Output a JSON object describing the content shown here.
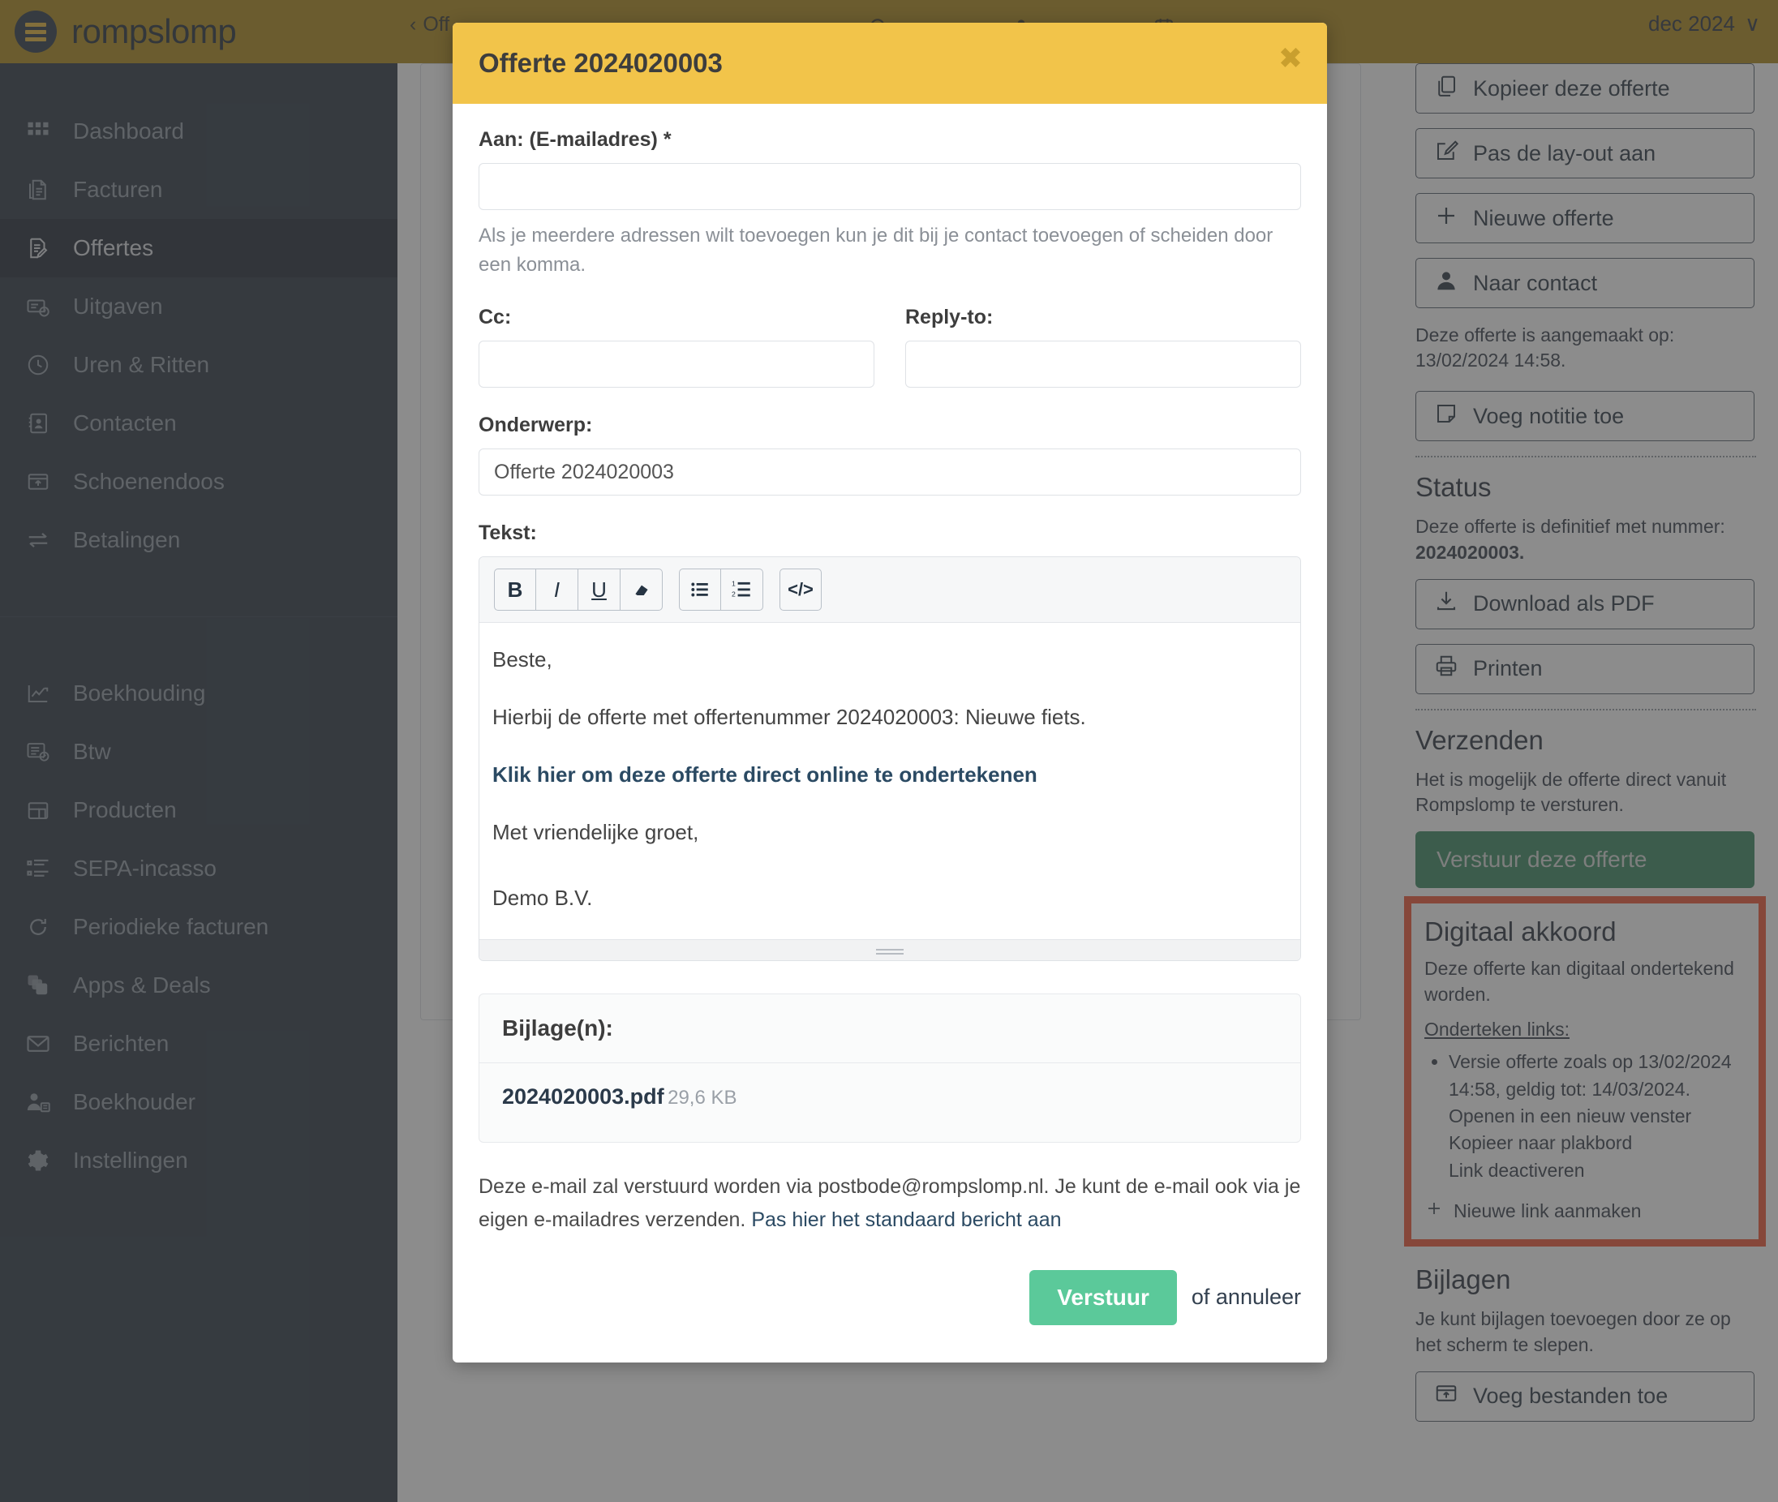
{
  "topbar": {
    "brand": "rompslomp",
    "breadcrumb": "Off",
    "back_chevron": "‹",
    "period": "dec 2024",
    "period_chevron": "∨"
  },
  "sidebar": {
    "group1": [
      {
        "label": "Dashboard",
        "icon": "grid-icon",
        "active": false
      },
      {
        "label": "Facturen",
        "icon": "invoice-icon",
        "active": false
      },
      {
        "label": "Offertes",
        "icon": "quote-edit-icon",
        "active": true
      },
      {
        "label": "Uitgaven",
        "icon": "expense-card-icon",
        "active": false
      },
      {
        "label": "Uren & Ritten",
        "icon": "clock-icon",
        "active": false
      },
      {
        "label": "Contacten",
        "icon": "contacts-icon",
        "active": false
      },
      {
        "label": "Schoenendoos",
        "icon": "inbox-upload-icon",
        "active": false
      },
      {
        "label": "Betalingen",
        "icon": "transfer-arrows-icon",
        "active": false
      }
    ],
    "group2": [
      {
        "label": "Boekhouding",
        "icon": "chart-up-icon",
        "active": false
      },
      {
        "label": "Btw",
        "icon": "vat-percent-icon",
        "active": false
      },
      {
        "label": "Producten",
        "icon": "box-icon",
        "active": false
      },
      {
        "label": "SEPA-incasso",
        "icon": "list-icon",
        "active": false
      },
      {
        "label": "Periodieke facturen",
        "icon": "refresh-icon",
        "active": false
      },
      {
        "label": "Apps & Deals",
        "icon": "stack-icon",
        "active": false
      },
      {
        "label": "Berichten",
        "icon": "envelope-icon",
        "active": false
      },
      {
        "label": "Boekhouder",
        "icon": "accountant-icon",
        "active": false
      },
      {
        "label": "Instellingen",
        "icon": "gear-icon",
        "active": false
      }
    ]
  },
  "rail": {
    "buttons_top": [
      {
        "label": "Kopieer deze offerte",
        "icon": "copy-icon"
      },
      {
        "label": "Pas de lay-out aan",
        "icon": "edit-square-icon"
      },
      {
        "label": "Nieuwe offerte",
        "icon": "plus-icon"
      },
      {
        "label": "Naar contact",
        "icon": "person-icon"
      }
    ],
    "created_note": "Deze offerte is aangemaakt op: 13/02/2024 14:58.",
    "note_button": {
      "label": "Voeg notitie toe",
      "icon": "note-icon"
    },
    "status": {
      "heading": "Status",
      "text_prefix": "Deze offerte is definitief met nummer:",
      "number": "2024020003.",
      "download_button": {
        "label": "Download als PDF",
        "icon": "download-icon"
      },
      "print_button": {
        "label": "Printen",
        "icon": "printer-icon"
      }
    },
    "send": {
      "heading": "Verzenden",
      "text": "Het is mogelijk de offerte direct vanuit Rompslomp te versturen.",
      "button_label": "Verstuur deze offerte"
    },
    "digital": {
      "heading": "Digitaal akkoord",
      "text": "Deze offerte kan digitaal ondertekend worden.",
      "sub": "Onderteken links:",
      "item": "Versie offerte zoals op 13/02/2024 14:58, geldig tot: 14/03/2024.",
      "links": [
        "Openen in een nieuw venster",
        "Kopieer naar plakbord",
        "Link deactiveren"
      ],
      "new_link": "Nieuwe link aanmaken",
      "highlight_color": "#f04b28"
    },
    "attachments": {
      "heading": "Bijlagen",
      "text": "Je kunt bijlagen toevoegen door ze op het scherm te slepen.",
      "button": {
        "label": "Voeg bestanden toe",
        "icon": "upload-box-icon"
      }
    }
  },
  "modal": {
    "title": "Offerte 2024020003",
    "close_glyph": "✖",
    "to_label": "Aan: (E-mailadres) *",
    "to_value": "",
    "to_help": "Als je meerdere adressen wilt toevoegen kun je dit bij je contact toevoegen of scheiden door een komma.",
    "cc_label": "Cc:",
    "cc_value": "",
    "reply_label": "Reply-to:",
    "reply_value": "",
    "subject_label": "Onderwerp:",
    "subject_value": "Offerte 2024020003",
    "text_label": "Tekst:",
    "toolbar": [
      {
        "name": "bold-icon",
        "glyph": "B"
      },
      {
        "name": "italic-icon",
        "glyph": "I"
      },
      {
        "name": "underline-icon",
        "glyph": "U"
      },
      {
        "name": "eraser-icon",
        "glyph": "▰"
      },
      {
        "name": "bullet-list-icon",
        "glyph": "☰"
      },
      {
        "name": "numbered-list-icon",
        "glyph": "☷"
      },
      {
        "name": "code-icon",
        "glyph": "</>"
      }
    ],
    "body": {
      "greeting": "Beste,",
      "line1": "Hierbij de offerte met offertenummer 2024020003: Nieuwe fiets.",
      "link": "Klik hier om deze offerte direct online te ondertekenen",
      "closing": "Met vriendelijke groet,",
      "company": "Demo B.V."
    },
    "attachments_heading": "Bijlage(n):",
    "attachment_name": "2024020003.pdf",
    "attachment_size": "29,6 KB",
    "footer_note_1": "Deze e-mail zal verstuurd worden via postbode@rompslomp.nl. Je kunt de e-mail ook via je eigen e-mailadres verzenden.",
    "footer_note_link": "Pas hier het standaard bericht aan",
    "send_label": "Verstuur",
    "cancel_label": "of annuleer"
  },
  "colors": {
    "header_gold": "#a8820c",
    "modal_gold": "#f2c44a",
    "sidebar": "#1d2836",
    "send_green": "#5bc99a",
    "rail_green": "#2e8057",
    "highlight_red": "#f04b28"
  }
}
